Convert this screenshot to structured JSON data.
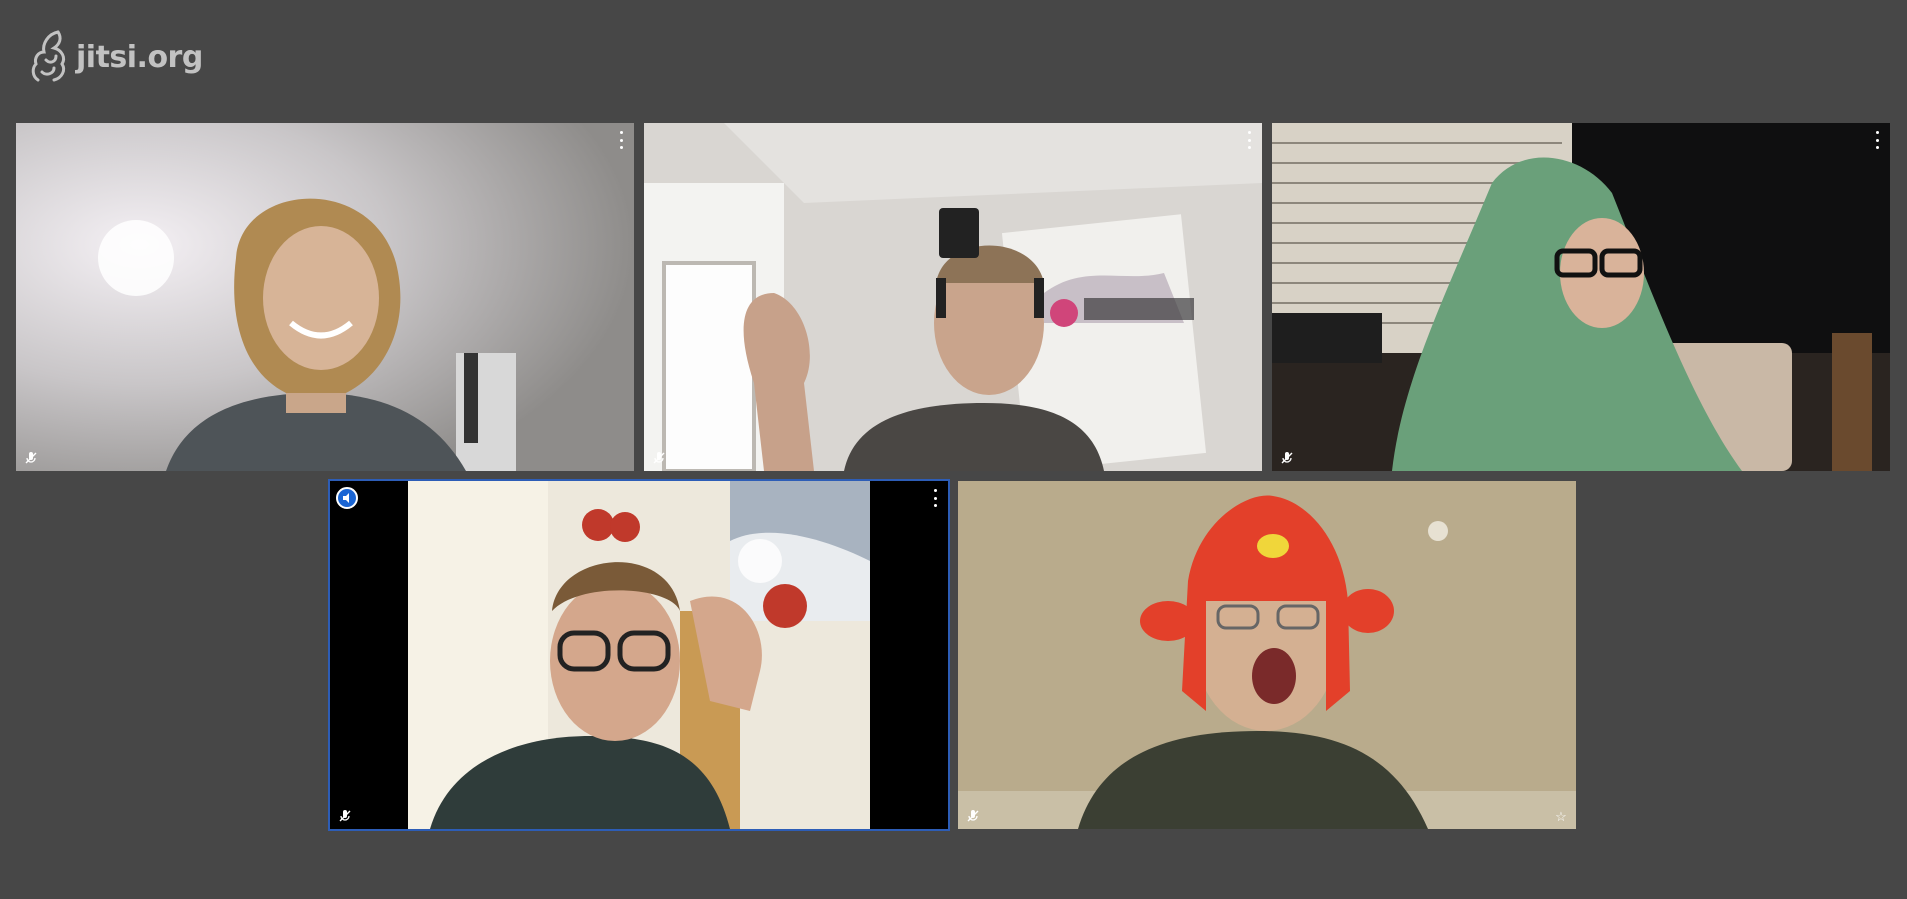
{
  "watermark": {
    "text": "jitsi.org",
    "icon": "jitsi-logo-icon"
  },
  "colors": {
    "background": "#474747",
    "active_border": "#2d5db6",
    "speaker_badge": "#1a65d4"
  },
  "participants": [
    {
      "id": 1,
      "audio_muted": true,
      "has_menu": true,
      "dominant_speaker": false,
      "icons": [
        "mic-muted-icon",
        "more-options-icon"
      ]
    },
    {
      "id": 2,
      "audio_muted": true,
      "has_menu": true,
      "dominant_speaker": false,
      "icons": [
        "mic-muted-icon",
        "more-options-icon"
      ]
    },
    {
      "id": 3,
      "audio_muted": true,
      "has_menu": true,
      "dominant_speaker": false,
      "icons": [
        "mic-muted-icon",
        "more-options-icon"
      ]
    },
    {
      "id": 4,
      "audio_muted": true,
      "has_menu": true,
      "dominant_speaker": true,
      "icons": [
        "speaker-indicator-icon",
        "mic-muted-icon",
        "more-options-icon"
      ]
    },
    {
      "id": 5,
      "audio_muted": true,
      "has_menu": false,
      "moderator": true,
      "icons": [
        "mic-muted-icon",
        "star-icon"
      ]
    }
  ]
}
